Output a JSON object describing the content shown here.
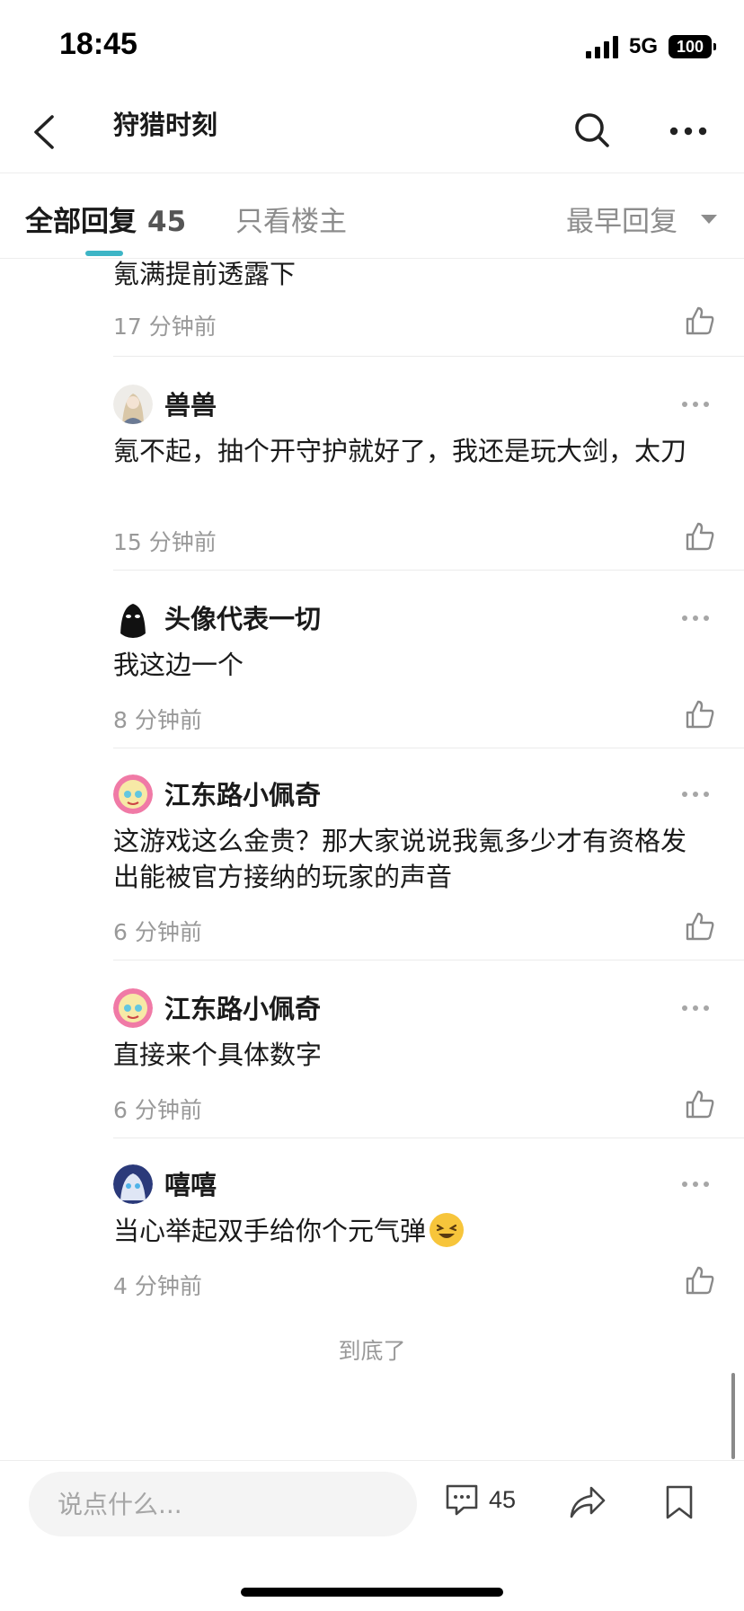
{
  "status_bar": {
    "time": "18:45",
    "network": "5G",
    "battery": "100"
  },
  "nav": {
    "title": "狩猎时刻",
    "back_icon": "chevron-left-icon",
    "search_icon": "search-icon",
    "more_icon": "more-horizontal-icon"
  },
  "tabs": {
    "all_label": "全部回复",
    "all_count": "45",
    "owner_label": "只看楼主",
    "sort_label": "最早回复",
    "accent_color": "#3db5c6"
  },
  "partial_comment": {
    "text": "氪满提前透露下",
    "time": "17 分钟前"
  },
  "comments": [
    {
      "user": "兽兽",
      "body": "氪不起，抽个开守护就好了，我还是玩大剑，太刀",
      "time": "15 分钟前"
    },
    {
      "user": "头像代表一切",
      "body": "我这边一个",
      "time": "8 分钟前"
    },
    {
      "user": "江东路小佩奇",
      "body": "这游戏这么金贵？那大家说说我氪多少才有资格发出能被官方接纳的玩家的声音",
      "time": "6 分钟前"
    },
    {
      "user": "江东路小佩奇",
      "body": "直接来个具体数字",
      "time": "6 分钟前"
    },
    {
      "user": "嘻嘻",
      "body": "当心举起双手给你个元气弹",
      "time": "4 分钟前"
    }
  ],
  "end_text": "到底了",
  "bottom_bar": {
    "input_placeholder": "说点什么...",
    "comment_count": "45"
  }
}
